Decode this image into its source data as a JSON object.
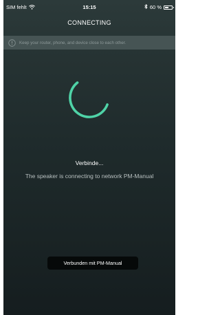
{
  "status_bar": {
    "carrier": "SIM fehlt",
    "time": "15:15",
    "battery": "60 %",
    "battery_level": 0.6
  },
  "header": {
    "title": "CONNECTING"
  },
  "banner": {
    "text": "Keep your router, phone, and device close to each other."
  },
  "main": {
    "heading": "Verbinde...",
    "description": "The speaker is connecting to network PM-Manual"
  },
  "toast": {
    "text": "Verbunden mit PM-Manual"
  },
  "colors": {
    "spinner": "#4fd3a7",
    "banner_bg": "#465454",
    "toast_bg": "#060909"
  }
}
